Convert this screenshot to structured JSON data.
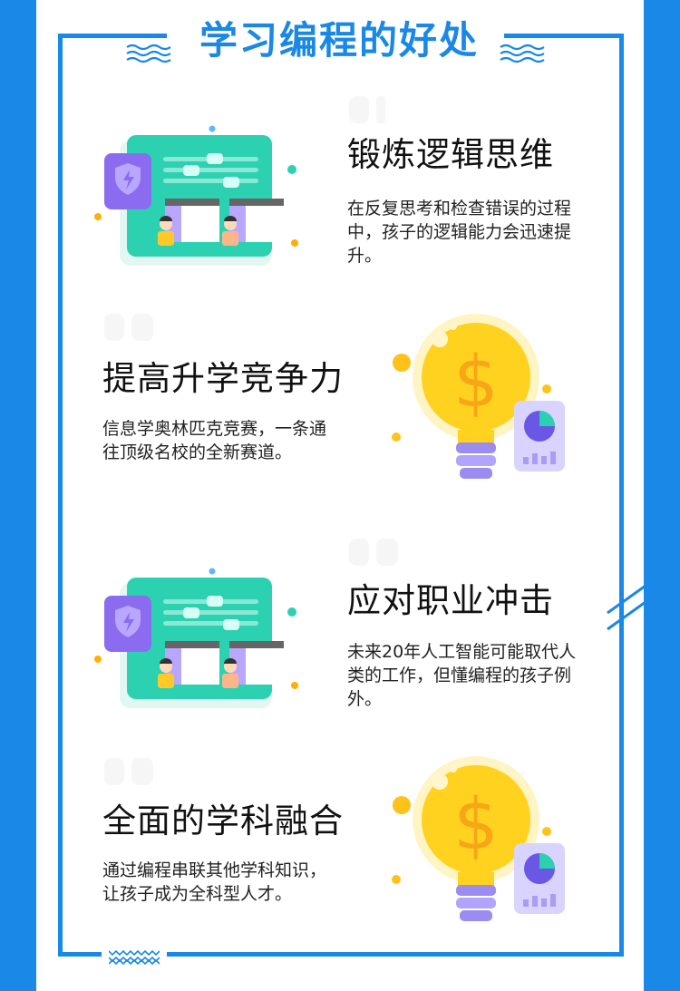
{
  "header": {
    "title": "学习编程的好处"
  },
  "sections": [
    {
      "title": "锻炼逻辑思维",
      "desc": "在反复思考和检查错误的过程中，孩子的逻辑能力会迅速提升。"
    },
    {
      "title": "提高升学竞争力",
      "desc": "信息学奥林匹克竞赛，一条通往顶级名校的全新赛道。"
    },
    {
      "title": "应对职业冲击",
      "desc": "未来20年人工智能可能取代人类的工作，但懂编程的孩子例外。"
    },
    {
      "title": "全面的学科融合",
      "desc": "通过编程串联其他学科知识，让孩子成为全科型人才。"
    }
  ],
  "illustrations": {
    "computer": {
      "icon": "computer-screen-icon",
      "shield_icon": "shield-lightning-icon",
      "person_icon": "person-icon"
    },
    "bulb": {
      "icon": "light-bulb-dollar-icon",
      "chart_icon": "pie-chart-card-icon",
      "symbol": "$"
    }
  },
  "colors": {
    "brand_blue": "#1a88e6",
    "teal": "#2bd1b0",
    "purple": "#8b6cf0",
    "bulb_yellow": "#ffd21f",
    "dot_orange": "#ffb000",
    "text": "#111111"
  }
}
